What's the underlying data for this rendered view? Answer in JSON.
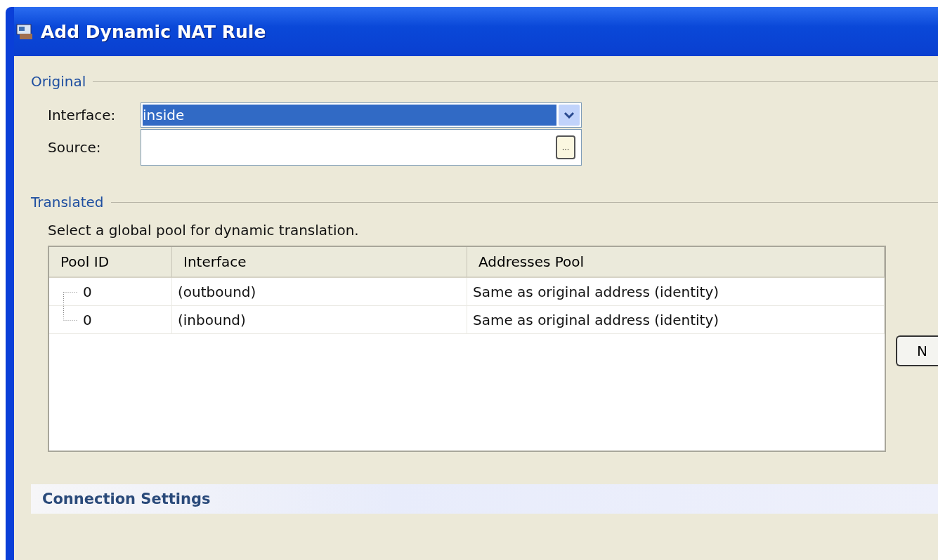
{
  "window": {
    "title": "Add Dynamic NAT Rule"
  },
  "original": {
    "legend": "Original",
    "interface": {
      "label": "Interface:",
      "value": "inside"
    },
    "source": {
      "label": "Source:",
      "browse_button": "..."
    }
  },
  "translated": {
    "legend": "Translated",
    "instruction": "Select a global pool for dynamic translation.",
    "table": {
      "columns": [
        "Pool ID",
        "Interface",
        "Addresses Pool"
      ],
      "rows": [
        {
          "pool_id": "0",
          "interface": "(outbound)",
          "addresses_pool": "Same as original address (identity)"
        },
        {
          "pool_id": "0",
          "interface": "(inbound)",
          "addresses_pool": "Same as original address (identity)"
        }
      ]
    },
    "side_button": "N"
  },
  "section": {
    "title": "Connection Settings"
  }
}
